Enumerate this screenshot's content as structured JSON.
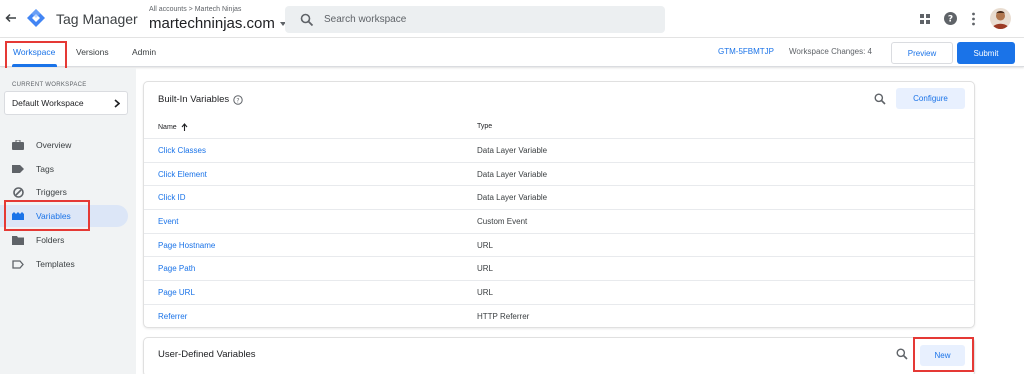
{
  "header": {
    "app_title": "Tag Manager",
    "breadcrumb": "All accounts > Martech Ninjas",
    "account_name": "martechninjas.com",
    "search_placeholder": "Search workspace"
  },
  "nav": {
    "tabs": [
      {
        "label": "Workspace",
        "active": true
      },
      {
        "label": "Versions",
        "active": false
      },
      {
        "label": "Admin",
        "active": false
      }
    ],
    "container_id": "GTM-5FBMTJP",
    "workspace_changes": "Workspace Changes: 4",
    "preview_label": "Preview",
    "submit_label": "Submit"
  },
  "sidebar": {
    "current_workspace_label": "CURRENT WORKSPACE",
    "workspace_name": "Default Workspace",
    "items": [
      {
        "label": "Overview",
        "icon": "briefcase-icon"
      },
      {
        "label": "Tags",
        "icon": "tag-icon"
      },
      {
        "label": "Triggers",
        "icon": "trigger-icon"
      },
      {
        "label": "Variables",
        "icon": "variables-icon",
        "active": true
      },
      {
        "label": "Folders",
        "icon": "folder-icon"
      },
      {
        "label": "Templates",
        "icon": "template-icon"
      }
    ]
  },
  "builtin": {
    "title": "Built-In Variables",
    "configure_label": "Configure",
    "col_name": "Name",
    "col_type": "Type",
    "rows": [
      {
        "name": "Click Classes",
        "type": "Data Layer Variable"
      },
      {
        "name": "Click Element",
        "type": "Data Layer Variable"
      },
      {
        "name": "Click ID",
        "type": "Data Layer Variable"
      },
      {
        "name": "Event",
        "type": "Custom Event"
      },
      {
        "name": "Page Hostname",
        "type": "URL"
      },
      {
        "name": "Page Path",
        "type": "URL"
      },
      {
        "name": "Page URL",
        "type": "URL"
      },
      {
        "name": "Referrer",
        "type": "HTTP Referrer"
      }
    ]
  },
  "userdefined": {
    "title": "User-Defined Variables",
    "new_label": "New"
  },
  "colors": {
    "accent": "#1a73e8",
    "highlight": "#e53935",
    "sidebar_bg": "#f1f3f4"
  }
}
